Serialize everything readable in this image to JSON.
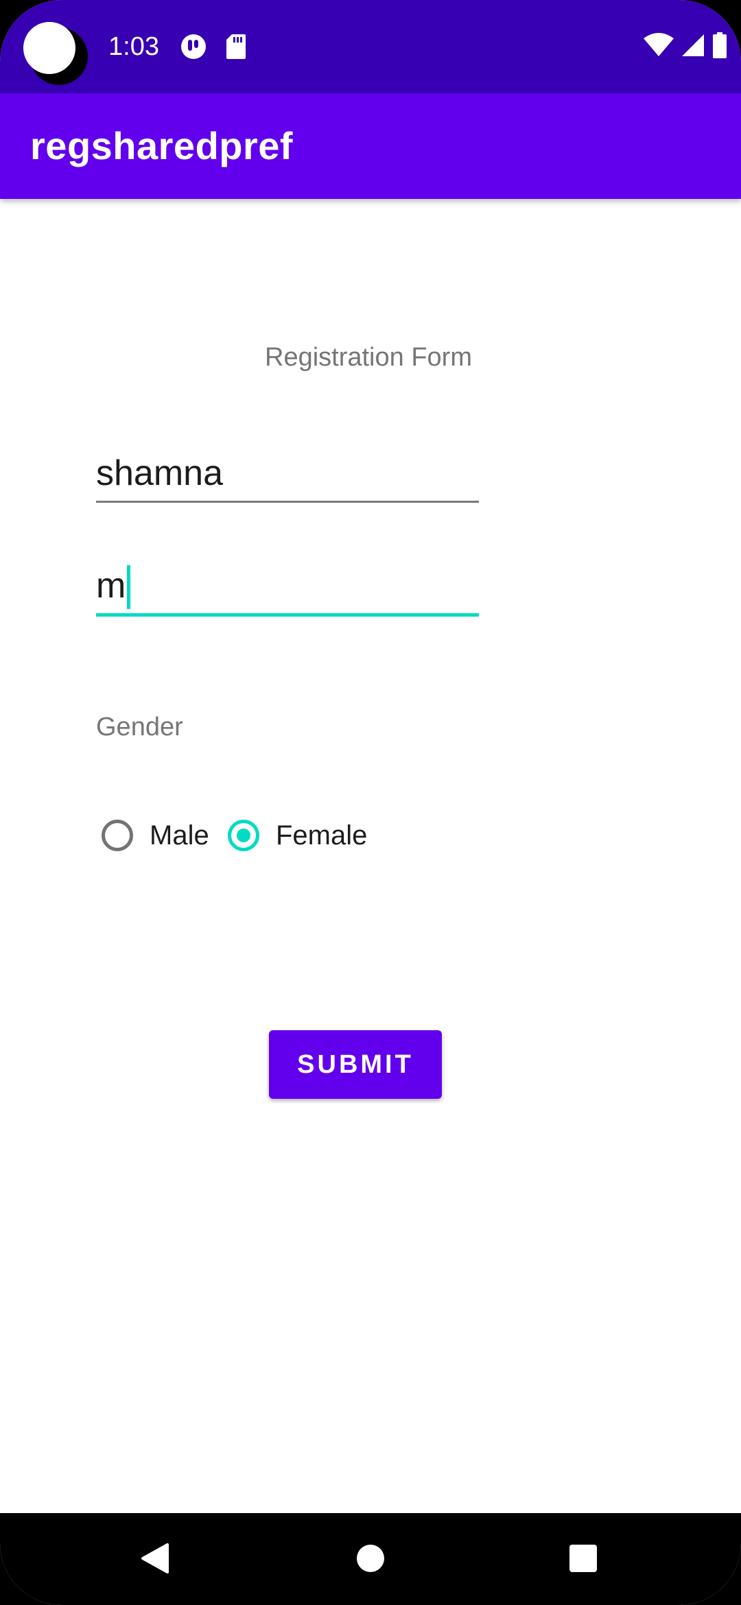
{
  "status_bar": {
    "time": "1:03",
    "left_icons": [
      "app-notification-icon",
      "sd-card-icon"
    ],
    "right_icons": [
      "wifi-icon",
      "cell-signal-icon",
      "battery-icon"
    ]
  },
  "app_bar": {
    "title": "regsharedpref"
  },
  "form": {
    "title": "Registration Form",
    "name_value": "shamna",
    "second_value": "m",
    "gender_label": "Gender",
    "gender_options": [
      {
        "label": "Male",
        "selected": false
      },
      {
        "label": "Female",
        "selected": true
      }
    ],
    "submit_label": "SUBMIT"
  },
  "nav_bar": {
    "buttons": [
      "back-icon",
      "home-icon",
      "recents-icon"
    ]
  },
  "colors": {
    "status_bar": "#3700B3",
    "primary": "#6200EE",
    "accent": "#03DAC5"
  }
}
